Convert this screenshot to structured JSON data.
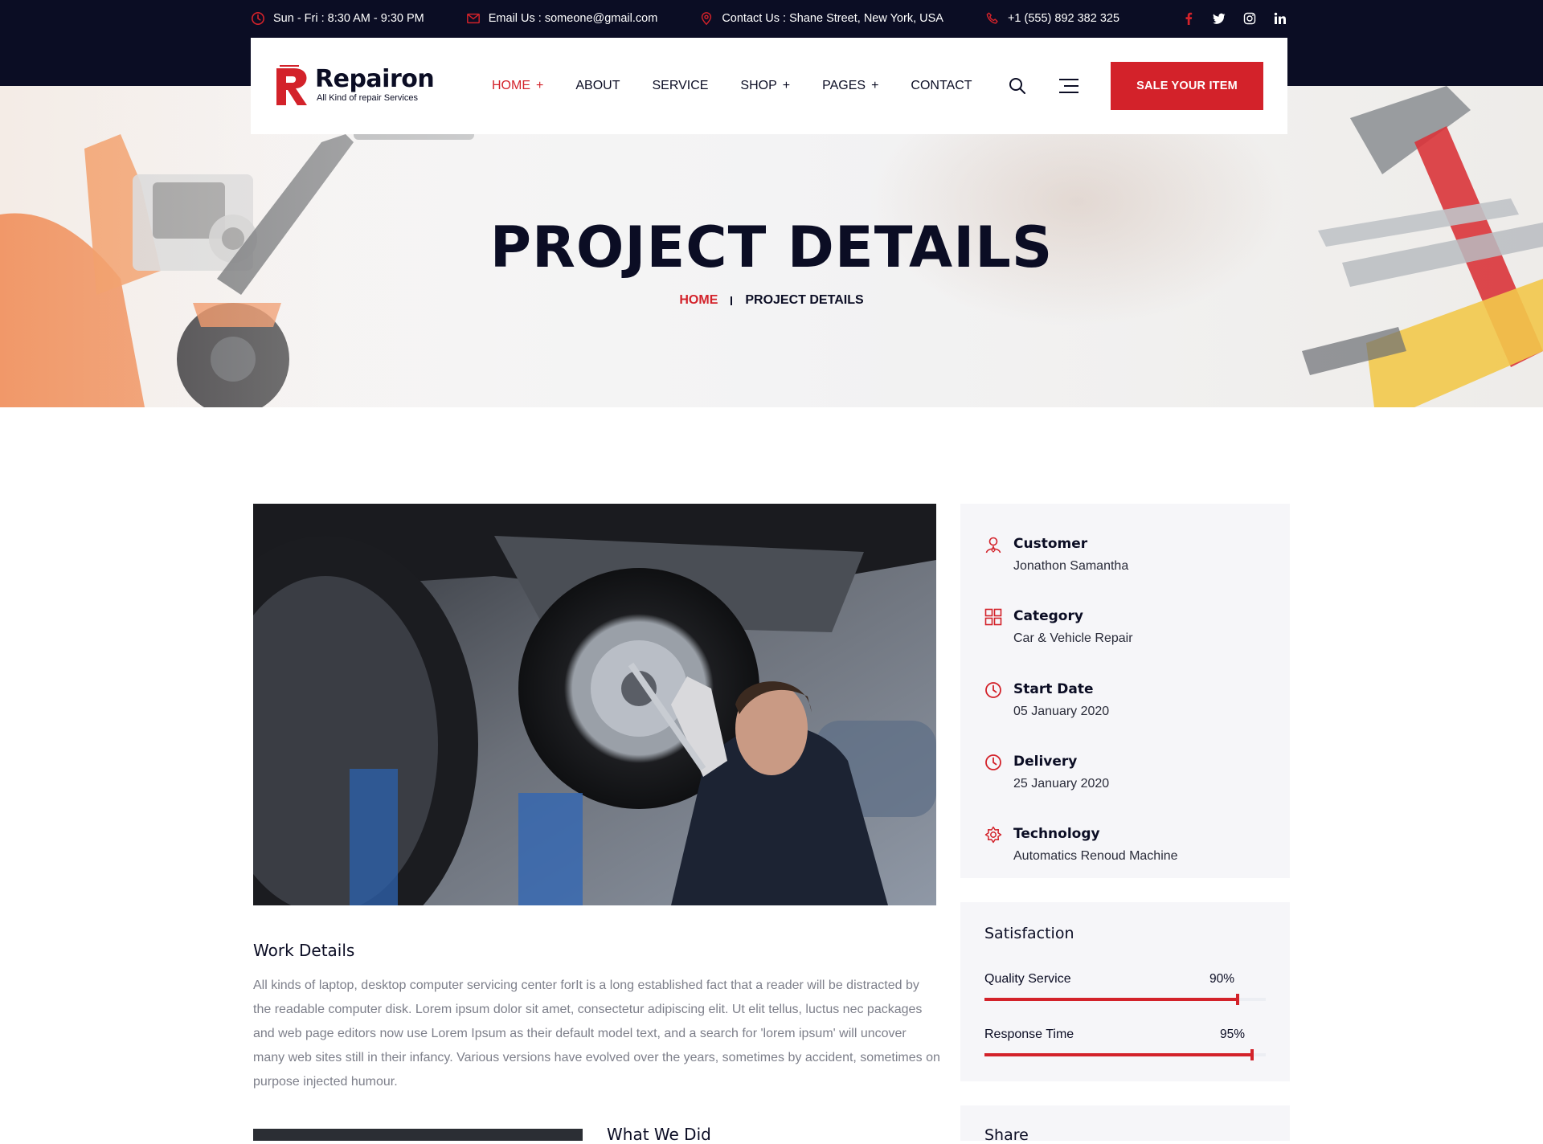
{
  "topbar": {
    "hours": "Sun - Fri : 8:30 AM - 9:30 PM",
    "email": "Email Us : someone@gmail.com",
    "address": "Contact Us : Shane Street, New York, USA",
    "phone": "+1 (555) 892 382 325",
    "social": [
      "facebook-icon",
      "twitter-icon",
      "instagram-icon",
      "linkedin-icon"
    ]
  },
  "logo": {
    "name": "Repairon",
    "tagline": "All Kind of repair Services"
  },
  "nav": {
    "items": [
      {
        "label": "HOME",
        "plus": "+",
        "active": true
      },
      {
        "label": "ABOUT",
        "plus": "",
        "active": false
      },
      {
        "label": "SERVICE",
        "plus": "",
        "active": false
      },
      {
        "label": "SHOP",
        "plus": "+",
        "active": false
      },
      {
        "label": "PAGES",
        "plus": "+",
        "active": false
      },
      {
        "label": "CONTACT",
        "plus": "",
        "active": false
      }
    ],
    "cta_label": "SALE YOUR ITEM"
  },
  "hero": {
    "title": "PROJECT DETAILS",
    "breadcrumb_home": "HOME",
    "breadcrumb_current": "PROJECT DETAILS"
  },
  "work": {
    "title": "Work Details",
    "text": "All kinds of laptop, desktop computer servicing center forIt is a long established fact that a reader will be distracted by the readable computer disk. Lorem ipsum dolor sit amet, consectetur adipiscing elit. Ut elit tellus, luctus nec packages and web page editors now use Lorem Ipsum as their default model text, and a search for 'lorem ipsum' will uncover many web sites still in their infancy. Various versions have evolved over the years, sometimes by accident, sometimes on purpose injected humour.",
    "what_title": "What We Did"
  },
  "info": {
    "items": [
      {
        "label": "Customer",
        "value": "Jonathon Samantha",
        "icon": "user-icon"
      },
      {
        "label": "Category",
        "value": "Car & Vehicle Repair",
        "icon": "grid-icon"
      },
      {
        "label": "Start Date",
        "value": "05 January 2020",
        "icon": "clock-icon"
      },
      {
        "label": "Delivery",
        "value": "25 January 2020",
        "icon": "clock-icon"
      },
      {
        "label": "Technology",
        "value": "Automatics Renoud Machine",
        "icon": "gear-icon"
      }
    ]
  },
  "satisfaction": {
    "title": "Satisfaction",
    "bars": [
      {
        "label": "Quality Service",
        "pct_label": "90%",
        "value": 0.9
      },
      {
        "label": "Response Time",
        "pct_label": "95%",
        "value": 0.95
      }
    ]
  },
  "share": {
    "title": "Share"
  },
  "colors": {
    "accent": "#d3222a",
    "dark": "#0b0d24",
    "card": "#f6f6f9",
    "muted_text": "#7d7f8a"
  }
}
